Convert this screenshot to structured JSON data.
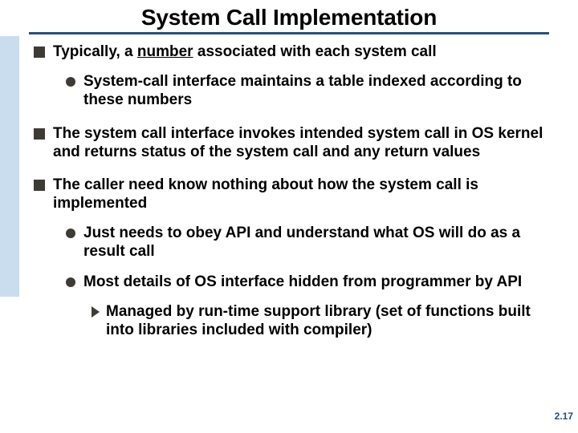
{
  "title": "System Call Implementation",
  "bullets": {
    "b1_pre": "Typically, a ",
    "b1_u": "number",
    "b1_post": " associated with each system call",
    "b1a": "System-call interface maintains a table indexed according to these numbers",
    "b2": "The system call interface invokes intended system call in OS kernel and returns status of the system call and any return values",
    "b3": "The caller need know nothing about how the system call is implemented",
    "b3a": "Just needs to obey API and understand what OS will do as a result call",
    "b3b": "Most details of  OS interface hidden from programmer by API",
    "b3b1": "Managed by run-time support library (set of functions built into libraries included with compiler)"
  },
  "slide_number": "2.17"
}
